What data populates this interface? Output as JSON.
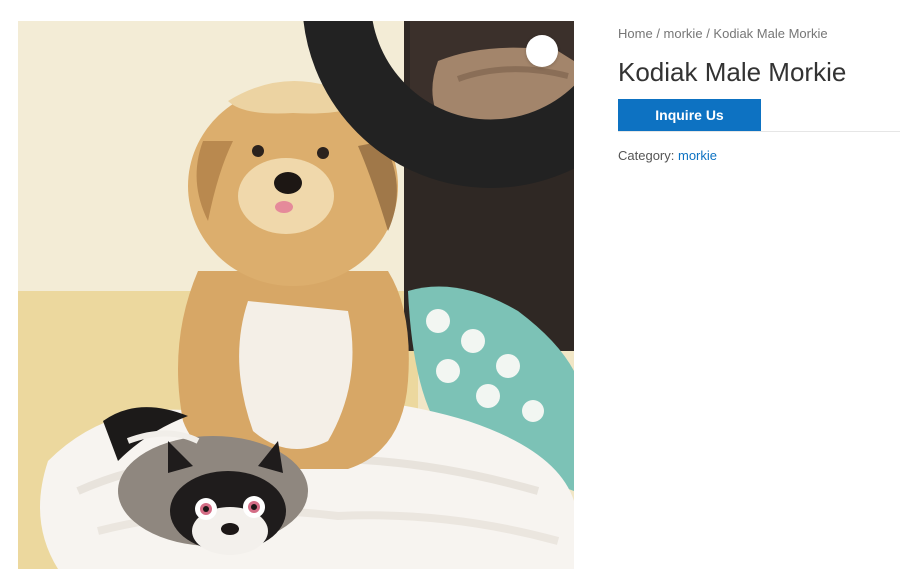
{
  "breadcrumb": {
    "items": [
      "Home",
      "morkie",
      "Kodiak Male Morkie"
    ],
    "separator": "/"
  },
  "product": {
    "title": "Kodiak Male Morkie",
    "cta_label": "Inquire Us",
    "category_label": "Category:",
    "category_value": "morkie"
  },
  "gallery": {
    "zoom_icon": "search-icon"
  },
  "colors": {
    "accent": "#0d72c2",
    "text": "#333333",
    "muted": "#767676"
  }
}
